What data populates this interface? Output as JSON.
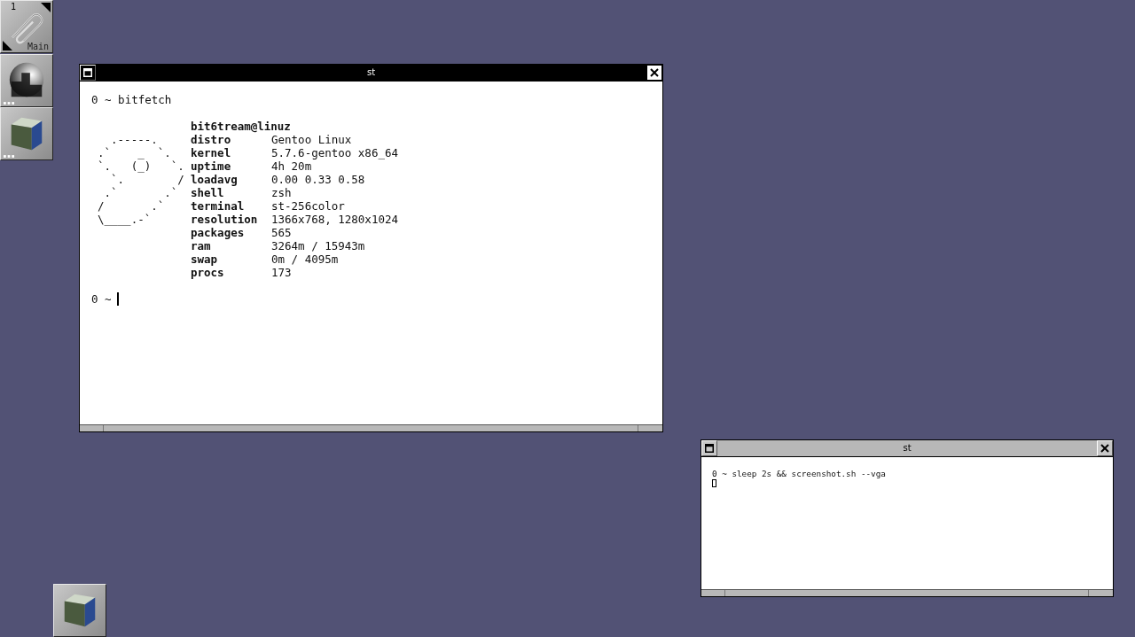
{
  "dock": {
    "workspace": "1",
    "workspace_name": "Main"
  },
  "windows": [
    {
      "title": "st",
      "focused": true,
      "command": "0 ~ bitfetch",
      "fetch": {
        "user": "bit6tream@linuz",
        "art": [
          "  .-----.",
          ".`    _  `.",
          "`.   (_)   `.",
          "  `.        /",
          " .`       .`",
          "/       .`",
          "\\____.-`"
        ],
        "fields": [
          {
            "label": "distro",
            "value": "Gentoo Linux"
          },
          {
            "label": "kernel",
            "value": "5.7.6-gentoo x86_64"
          },
          {
            "label": "uptime",
            "value": "4h 20m"
          },
          {
            "label": "loadavg",
            "value": "0.00 0.33 0.58"
          },
          {
            "label": "shell",
            "value": "zsh"
          },
          {
            "label": "terminal",
            "value": "st-256color"
          },
          {
            "label": "resolution",
            "value": "1366x768, 1280x1024"
          },
          {
            "label": "packages",
            "value": "565"
          },
          {
            "label": "ram",
            "value": "3264m / 15943m"
          },
          {
            "label": "swap",
            "value": "0m / 4095m"
          },
          {
            "label": "procs",
            "value": "173"
          }
        ]
      },
      "prompt": "0 ~"
    },
    {
      "title": "st",
      "focused": false,
      "command": "0 ~ sleep 2s && screenshot.sh --vga"
    }
  ]
}
